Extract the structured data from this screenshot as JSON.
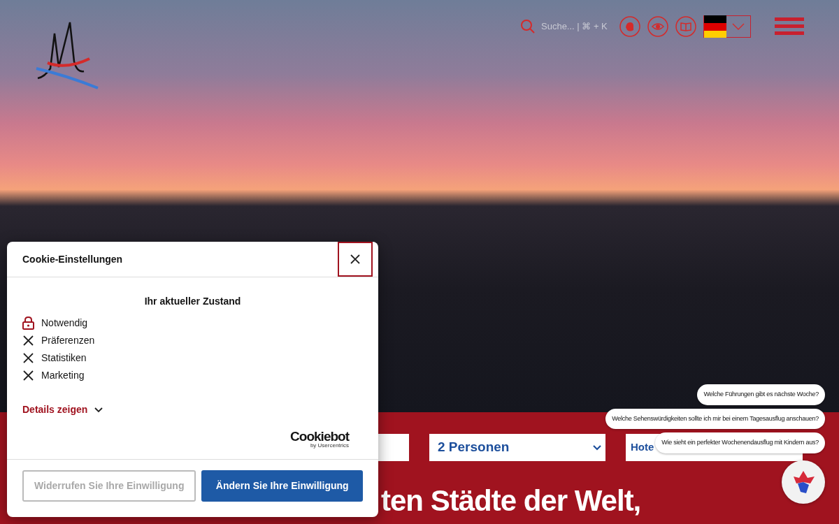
{
  "header": {
    "search_placeholder": "Suche... | ⌘ + K"
  },
  "booking": {
    "persons": "2 Personen",
    "accommodation": "Hote"
  },
  "headline": "ten Städte der Welt,",
  "cookie_dialog": {
    "title": "Cookie-Einstellungen",
    "status_heading": "Ihr aktueller Zustand",
    "categories": [
      {
        "label": "Notwendig",
        "kind": "locked"
      },
      {
        "label": "Präferenzen",
        "kind": "declined"
      },
      {
        "label": "Statistiken",
        "kind": "declined"
      },
      {
        "label": "Marketing",
        "kind": "declined"
      }
    ],
    "details_link": "Details zeigen",
    "brand": "Cookiebot",
    "brand_sub": "by Usercentrics",
    "buttons": [
      {
        "label": "Widerrufen Sie Ihre Einwilligung",
        "kind": "outline",
        "disabled": true
      },
      {
        "label": "Ändern Sie Ihre Einwilligung",
        "kind": "primary",
        "disabled": false
      }
    ]
  },
  "chat": {
    "suggestions": [
      "Welche Führungen gibt es nächste Woche?",
      "Welche Sehenswürdigkeiten sollte ich mir bei einem Tagesausflug anschauen?",
      "Wie sieht ein perfekter Wochenendausflug mit Kindern aus?"
    ]
  }
}
